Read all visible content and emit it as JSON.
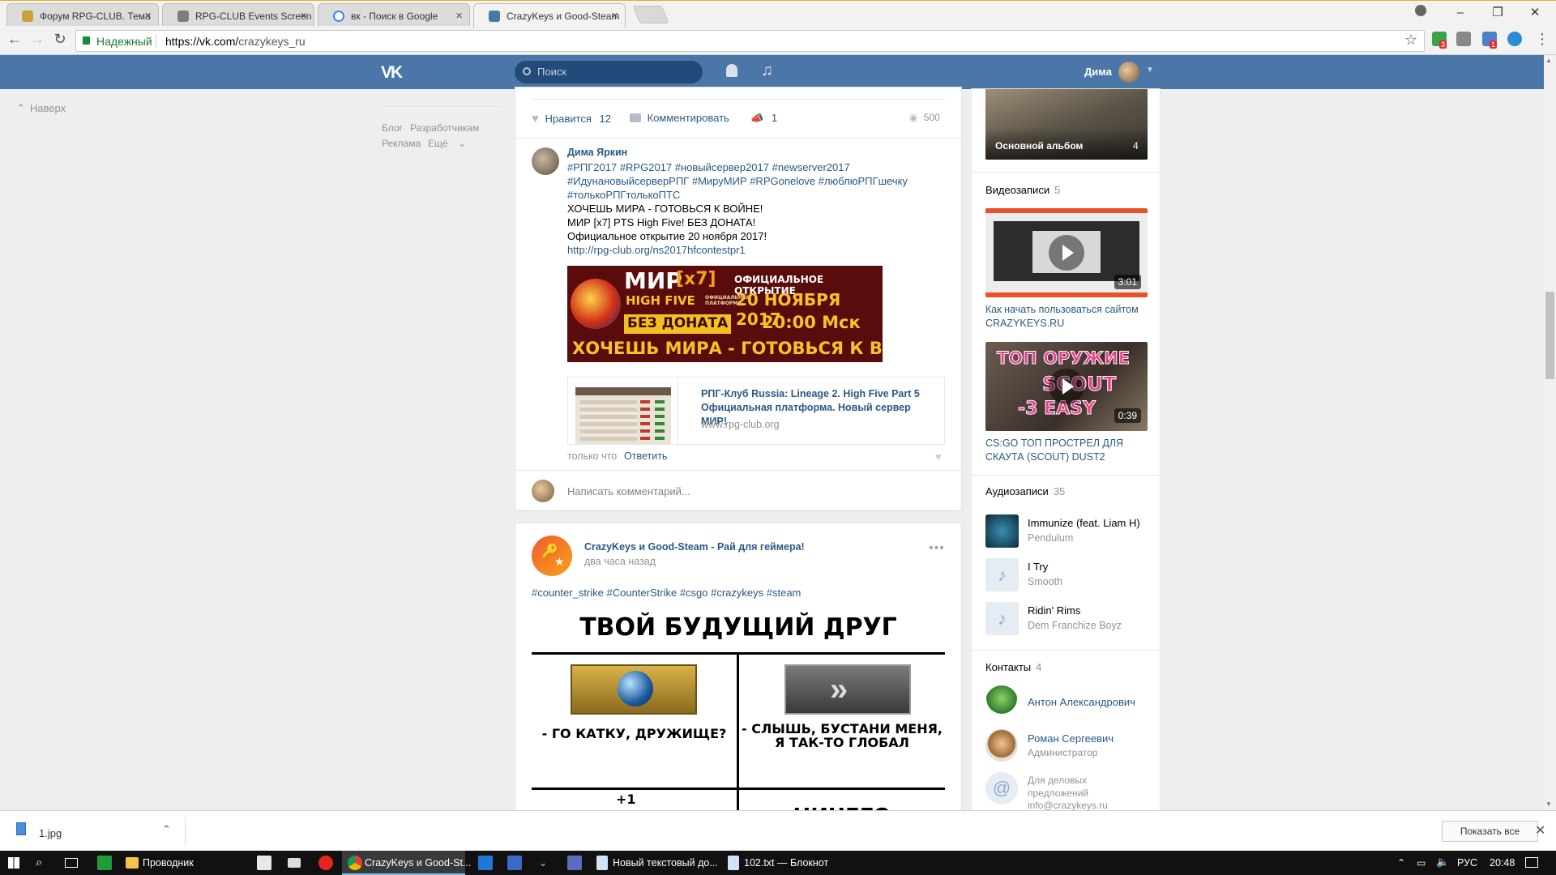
{
  "browser": {
    "tabs": [
      {
        "title": "Форум RPG-CLUB. Тема"
      },
      {
        "title": "RPG-CLUB Events Screen"
      },
      {
        "title": "вк - Поиск в Google"
      },
      {
        "title": "CrazyKeys и Good-Steam"
      }
    ],
    "secure_label": "Надежный",
    "url_host": "https://vk.com/",
    "url_path": "crazykeys_ru",
    "ext_badges": [
      "3",
      "1"
    ]
  },
  "vk_header": {
    "logo": "VK",
    "search_placeholder": "Поиск",
    "user_name": "Дима"
  },
  "left": {
    "to_top": "Наверх",
    "links": [
      "Блог",
      "Разработчикам",
      "Реклама",
      "Ещё"
    ]
  },
  "post1": {
    "like_label": "Нравится",
    "like_count": "12",
    "comment_label": "Комментировать",
    "share_count": "1",
    "views": "500",
    "comment": {
      "author": "Дима Яркин",
      "hashtags": "#РПГ2017 #RPG2017 #новыйсервер2017 #newserver2017 #ИдунановыйсерверРПГ #МируМИР #RPGonelove #люблюРПГшечку #толькоРПГтолькоПТС",
      "line1": "ХОЧЕШЬ МИРА - ГОТОВЬСЯ К ВОЙНЕ!",
      "line2": "МИР [x7] PTS High Five! БЕЗ ДОНАТА!",
      "line3": "Официальное открытие 20 ноября 2017!",
      "link": "http://rpg-club.org/ns2017hfcontestpr1",
      "banner": {
        "mir": "МИР",
        "x7": "[x7]",
        "hf": "HIGH FIVE",
        "platform": "ОФИЦИАЛЬНАЯ ПЛАТФОРМА",
        "opening": "ОФИЦИАЛЬНОЕ ОТКРЫТИЕ",
        "date": "20 НОЯБРЯ 2017",
        "time": "20:00 Мск",
        "nodonate": "БЕЗ ДОНАТА",
        "slogan": "ХОЧЕШЬ МИРА - ГОТОВЬСЯ К ВОЙНЕ"
      },
      "snippet_title": "РПГ-Клуб Russia: Lineage 2. High Five Part 5 Официальная платформа. Новый сервер МИР!",
      "snippet_domain": "www.rpg-club.org",
      "time": "только что",
      "reply": "Ответить"
    },
    "write_placeholder": "Написать комментарий..."
  },
  "post2": {
    "author": "CrazyKeys и Good-Steam - Рай для геймера!",
    "time": "два часа назад",
    "hashtags": "#counter_strike #CounterStrike #csgo #crazykeys #steam",
    "meme_title": "ТВОЙ БУДУЩИЙ ДРУГ",
    "left_caption": "- ГО КАТКУ, ДРУЖИЩЕ?",
    "right_caption_1": "- СЛЫШЬ, БУСТАНИ МЕНЯ,",
    "right_caption_2": "Я ТАК-ТО ГЛОБАЛ",
    "plus_one": "+1",
    "bottom_right": "НИЧЕГО"
  },
  "right": {
    "album_label": "Основной альбом",
    "album_count": "4",
    "videos_title": "Видеозаписи",
    "videos_count": "5",
    "videos": [
      {
        "duration": "3:01",
        "title": "Как начать пользоваться сайтом CRAZYKEYS.RU"
      },
      {
        "duration": "0:39",
        "title": "CS:GO ТОП ПРОСТРЕЛ ДЛЯ СКАУТА (SCOUT) DUST2",
        "overlay1": "ТОП ОРУЖИЕ",
        "overlay2": "SCOUT",
        "overlay3": "-3 EASY"
      }
    ],
    "audio_title": "Аудиозаписи",
    "audio_count": "35",
    "audio": [
      {
        "title": "Immunize (feat. Liam H)",
        "artist": "Pendulum"
      },
      {
        "title": "I Try",
        "artist": "Smooth"
      },
      {
        "title": "Ridin' Rims",
        "artist": "Dem Franchize Boyz"
      }
    ],
    "contacts_title": "Контакты",
    "contacts_count": "4",
    "contacts": [
      {
        "name": "Антон Александрович",
        "sub": ""
      },
      {
        "name": "Роман Сергеевич",
        "sub": "Администратор"
      },
      {
        "name": "Для деловых предложений",
        "sub": "info@crazykeys.ru"
      }
    ]
  },
  "download": {
    "file": "1.jpg",
    "show_all": "Показать все"
  },
  "taskbar": {
    "explorer": "Проводник",
    "chrome": "CrazyKeys и Good-St...",
    "notepad1": "Новый текстовый до...",
    "notepad2": "102.txt — Блокнот",
    "lang": "РУС",
    "clock": "20:48"
  }
}
